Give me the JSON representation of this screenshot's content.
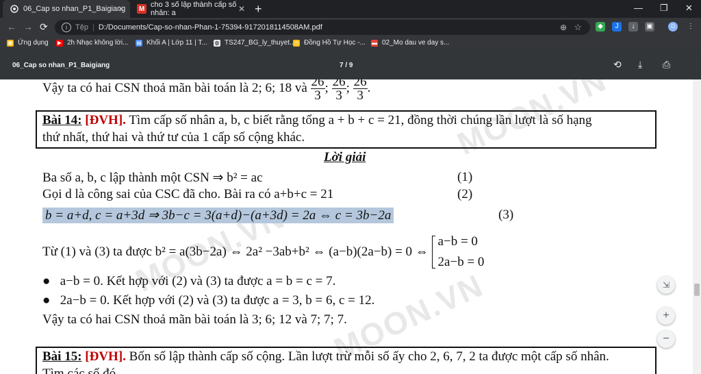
{
  "tabs": [
    {
      "title": "06_Cap so nhan_P1_Baigiang",
      "icon": "chrome-page-icon",
      "active": true
    },
    {
      "title": "cho 3 số lập thành cấp số nhân: a",
      "icon": "moon-m-icon",
      "active": false
    }
  ],
  "window": {
    "minimize": "—",
    "restore": "❐",
    "close": "✕"
  },
  "toolbar": {
    "scheme": "Tệp",
    "url": "D:/Documents/Cap-so-nhan-Phan-1-75394-9172018114508AM.pdf"
  },
  "bookmarks": [
    {
      "label": "Ứng dụng",
      "icon_color": "#f4b400"
    },
    {
      "label": "2h Nhạc không lời...",
      "icon_color": "#ff0000"
    },
    {
      "label": "Khối A | Lớp 11 | T...",
      "icon_color": "#4285f4"
    },
    {
      "label": "TS247_BG_ly_thuyet...",
      "icon_color": "#e8eaed"
    },
    {
      "label": "Đồng Hồ Tự Học -...",
      "icon_color": "#fbbc04"
    },
    {
      "label": "02_Mo dau ve day s...",
      "icon_color": "#ea4335"
    }
  ],
  "pdf": {
    "title": "06_Cap so nhan_P1_Baigiang",
    "page_indicator": "7 / 9"
  },
  "doc": {
    "line1_prefix": "Vậy ta có hai CSN thoả mãn bài toán là 2; 6; 18 và ",
    "frac_num": "26",
    "frac_den": "3",
    "bai14_label": "Bài 14:",
    "bai14_tag": "[ĐVH].",
    "bai14_text1": " Tìm cấp số nhân a, b, c biết rằng tổng a + b + c = 21, đồng thời chúng lần lượt là số hạng",
    "bai14_text2": "thứ nhất, thứ hai và thứ tư của 1 cấp số cộng khác.",
    "loigiai": "Lời giải",
    "l1_text": "Ba số a, b, c lập thành một CSN ⇒ b² = ac",
    "l1_num": "(1)",
    "l2_text": "Gọi d là công sai của CSC đã cho. Bài ra có  a+b+c = 21",
    "l2_num": "(2)",
    "l3_text": "b = a+d,  c = a+3d ⇒ 3b−c = 3(a+d)−(a+3d) = 2a ⇔ c = 3b−2a",
    "l3_num": "(3)",
    "l4_text": "Từ (1) và (3) ta được   b² = a(3b−2a) ⇔ 2a² −3ab+b² ⇔ (a−b)(2a−b) = 0 ⇔ ",
    "sys1": "a−b = 0",
    "sys2": "2a−b = 0",
    "bullet1": "a−b = 0.  Kết hợp với (2) và (3) ta được  a = b = c = 7.",
    "bullet2": "2a−b = 0.  Kết hợp với (2) và (3) ta được  a = 3,  b = 6,  c = 12.",
    "conclusion": "Vậy ta có hai CSN thoả mãn bài toán là 3; 6; 12 và 7; 7; 7.",
    "bai15_label": "Bài 15:",
    "bai15_tag": "[ĐVH].",
    "bai15_text1": " Bốn số lập thành cấp số cộng. Lần lượt trừ mỗi số ấy cho 2, 6, 7, 2 ta được một cấp số nhân.",
    "bai15_text2": "Tìm các số đó.",
    "watermark": "MOON.VN"
  },
  "zoom_controls": {
    "fit": "⇲",
    "plus": "+",
    "minus": "−"
  }
}
